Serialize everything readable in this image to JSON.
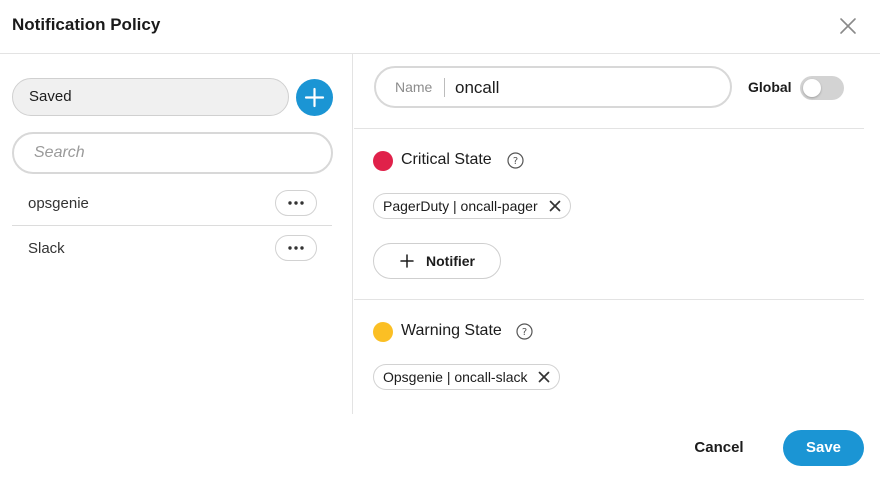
{
  "dialog": {
    "title": "Notification Policy"
  },
  "sidebar": {
    "saved_value": "Saved",
    "search_placeholder": "Search",
    "items": [
      {
        "label": "opsgenie"
      },
      {
        "label": "Slack"
      }
    ]
  },
  "form": {
    "name_label": "Name",
    "name_value": "oncall",
    "global_label": "Global",
    "global_enabled": false
  },
  "states": {
    "critical": {
      "title": "Critical State",
      "color": "#e0214a",
      "chips": [
        {
          "label": "PagerDuty | oncall-pager"
        }
      ],
      "add_notifier_label": "Notifier"
    },
    "warning": {
      "title": "Warning State",
      "color": "#fbbf24",
      "chips": [
        {
          "label": "Opsgenie | oncall-slack"
        }
      ]
    }
  },
  "footer": {
    "cancel_label": "Cancel",
    "save_label": "Save"
  },
  "colors": {
    "accent": "#1b95d4",
    "toggle_off": "#d3d3d3"
  }
}
